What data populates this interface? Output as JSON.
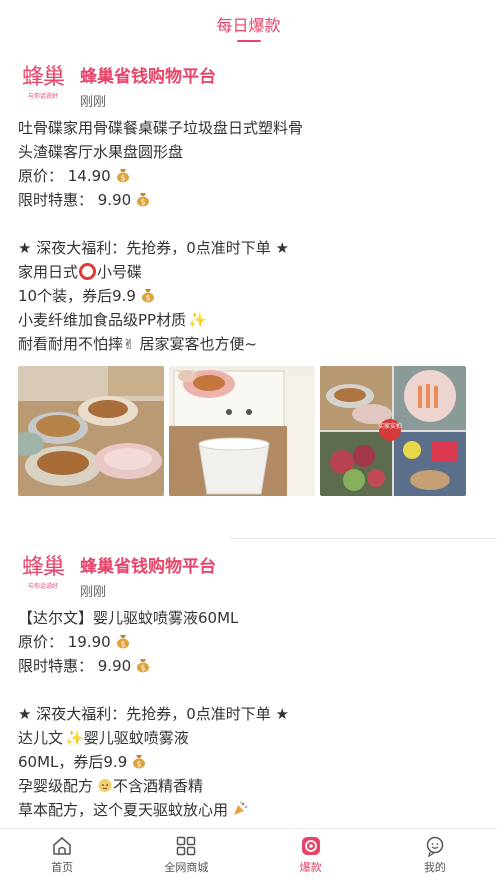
{
  "header": {
    "title": "每日爆款"
  },
  "posts": [
    {
      "shop_name": "蜂巢省钱购物平台",
      "logo_text": "蜂巢",
      "logo_sub": "与你话说好",
      "time": "刚刚",
      "lines": {
        "title1": "吐骨碟家用骨碟餐桌碟子垃圾盘日式塑料骨",
        "title2": "头渣碟客厅水果盘圆形盘",
        "orig_price": "原价： 14.90",
        "sale_price": "限时特惠： 9.90",
        "promo": "★ 深夜大福利：先抢券，0点准时下单 ★",
        "desc1_a": "家用日式",
        "desc1_b": "小号碟",
        "desc2": "10个装，券后9.9",
        "desc3": "小麦纤维加食品级PP材质",
        "desc4_a": "耐看耐用不怕摔",
        "desc4_b": "居家宴客也方便~"
      },
      "photo_badge": "实家实拍"
    },
    {
      "shop_name": "蜂巢省钱购物平台",
      "logo_text": "蜂巢",
      "logo_sub": "与你话说好",
      "time": "刚刚",
      "lines": {
        "title1": "【达尔文】婴儿驱蚊喷雾液60ML",
        "orig_price": "原价： 19.90",
        "sale_price": "限时特惠： 9.90",
        "promo": "★ 深夜大福利：先抢券，0点准时下单 ★",
        "desc1": "达儿文",
        "desc1_b": "婴儿驱蚊喷雾液",
        "desc2": "60ML，券后9.9",
        "desc3_a": "孕婴级配方",
        "desc3_b": "不含酒精香精",
        "desc4": "草本配方，这个夏天驱蚊放心用"
      }
    }
  ],
  "tabbar": {
    "items": [
      {
        "label": "首页",
        "icon": "home-icon"
      },
      {
        "label": "全网商城",
        "icon": "grid-icon"
      },
      {
        "label": "爆款",
        "icon": "hot-icon",
        "active": true
      },
      {
        "label": "我的",
        "icon": "profile-icon"
      }
    ]
  },
  "colors": {
    "accent": "#e8446a",
    "text": "#333333",
    "muted": "#666666"
  }
}
